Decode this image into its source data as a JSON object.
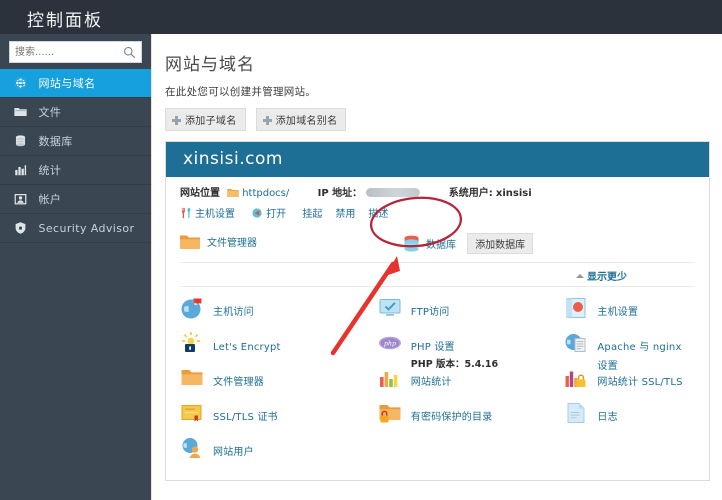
{
  "topbar": {
    "title": "控制面板"
  },
  "sidebar": {
    "search": {
      "placeholder": "搜索......",
      "value": "",
      "icon": "search-icon"
    },
    "items": [
      {
        "label": "网站与域名",
        "icon": "globe-icon",
        "active": true
      },
      {
        "label": "文件",
        "icon": "folder-icon",
        "active": false
      },
      {
        "label": "数据库",
        "icon": "database-icon",
        "active": false
      },
      {
        "label": "统计",
        "icon": "bar-chart-icon",
        "active": false
      },
      {
        "label": "帐户",
        "icon": "account-icon",
        "active": false
      },
      {
        "label": "Security Advisor",
        "icon": "shield-icon",
        "active": false
      }
    ]
  },
  "main": {
    "page_title": "网站与域名",
    "page_description": "在此处您可以创建并管理网站。",
    "buttons": [
      {
        "label": "添加子域名",
        "icon": "plus-icon"
      },
      {
        "label": "添加域名别名",
        "icon": "plus-icon"
      }
    ],
    "card": {
      "domain": "xinsisi.com",
      "info": {
        "location_label": "网站位置",
        "location_value": "httpdocs/",
        "ip_label": "IP 地址：",
        "ip_value": "",
        "ip_redacted": true,
        "sysuser_label": "系统用户:",
        "sysuser_value": "xinsisi"
      },
      "action_links": [
        {
          "label": "主机设置",
          "icon": "tools-icon"
        },
        {
          "label": "打开",
          "icon": "open-icon"
        },
        {
          "label": "挂起",
          "icon": ""
        },
        {
          "label": "禁用",
          "icon": ""
        },
        {
          "label": "描述",
          "icon": ""
        }
      ],
      "tools": {
        "file_manager": {
          "label": "文件管理器",
          "icon": "folder-orange-icon"
        },
        "database": {
          "label": "数据库",
          "icon": "database-red-icon"
        },
        "add_database": {
          "label": "添加数据库"
        }
      },
      "show_less": {
        "label": "显示更少",
        "icon": "chevron-up-icon"
      },
      "grid": [
        [
          {
            "label": "主机访问",
            "icon": "globe-flag-icon"
          },
          {
            "label": "FTP访问",
            "icon": "ftp-monitor-icon"
          },
          {
            "label": "主机设置",
            "icon": "hosting-settings-icon"
          }
        ],
        [
          {
            "label": "Let's Encrypt",
            "icon": "lets-encrypt-icon"
          },
          {
            "label": "PHP 设置",
            "icon": "php-icon",
            "sub": "PHP 版本：5.4.16"
          },
          {
            "label": "Apache 与 nginx 设置",
            "icon": "apache-nginx-icon"
          }
        ],
        [
          {
            "label": "文件管理器",
            "icon": "folder-orange-icon"
          },
          {
            "label": "网站统计",
            "icon": "stats-bars-icon"
          },
          {
            "label": "网站统计 SSL/TLS",
            "icon": "stats-lock-icon"
          }
        ],
        [
          {
            "label": "SSL/TLS 证书",
            "icon": "certificate-icon"
          },
          {
            "label": "有密码保护的目录",
            "icon": "protected-dir-icon"
          },
          {
            "label": "日志",
            "icon": "log-file-icon"
          }
        ],
        [
          {
            "label": "网站用户",
            "icon": "globe-user-icon"
          },
          {
            "label": "",
            "icon": ""
          },
          {
            "label": "",
            "icon": ""
          }
        ]
      ]
    }
  },
  "annotations": {
    "ellipse": {
      "color": "#b5253a",
      "target": "数据库"
    },
    "arrow": {
      "color": "#e8322d",
      "points_to": "数据库"
    }
  },
  "colors": {
    "topbar": "#2b323c",
    "sidebar": "#3b4653",
    "sidebar_active": "#16a0dd",
    "card_header": "#1d6f96",
    "link": "#1d6f96",
    "annotation_red": "#e8322d"
  }
}
